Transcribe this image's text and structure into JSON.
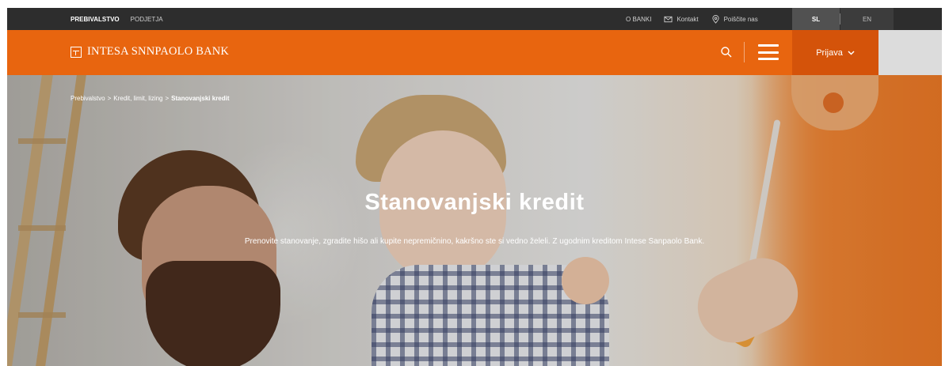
{
  "topbar": {
    "segments": [
      "PREBIVALSTVO",
      "PODJETJA"
    ],
    "utility": [
      "O BANKI",
      "Kontakt",
      "Poiščite nas"
    ],
    "languages": [
      "SL",
      "EN"
    ]
  },
  "header": {
    "logo": "INTESA SNNPAOLO BANK",
    "login_label": "Prijava"
  },
  "hero": {
    "breadcrumb": {
      "level1": "Prebivalstvo",
      "sep": ">",
      "level2": "Kredit, limit, lizing",
      "current": "Stanovanjski kredit"
    },
    "title": "Stanovanjski kredit",
    "subtitle": "Prenovite stanovanje, zgradite hišo ali kupite nepremičnino, kakršno ste si vedno želeli. Z ugodnim kreditom Intese Sanpaolo Bank."
  },
  "colors": {
    "brand_orange": "#e8650f",
    "topbar_dark": "#2d2d2d"
  },
  "icons": [
    "envelope-icon",
    "location-pin-icon",
    "search-icon",
    "hamburger-menu-icon",
    "chevron-down-icon"
  ]
}
